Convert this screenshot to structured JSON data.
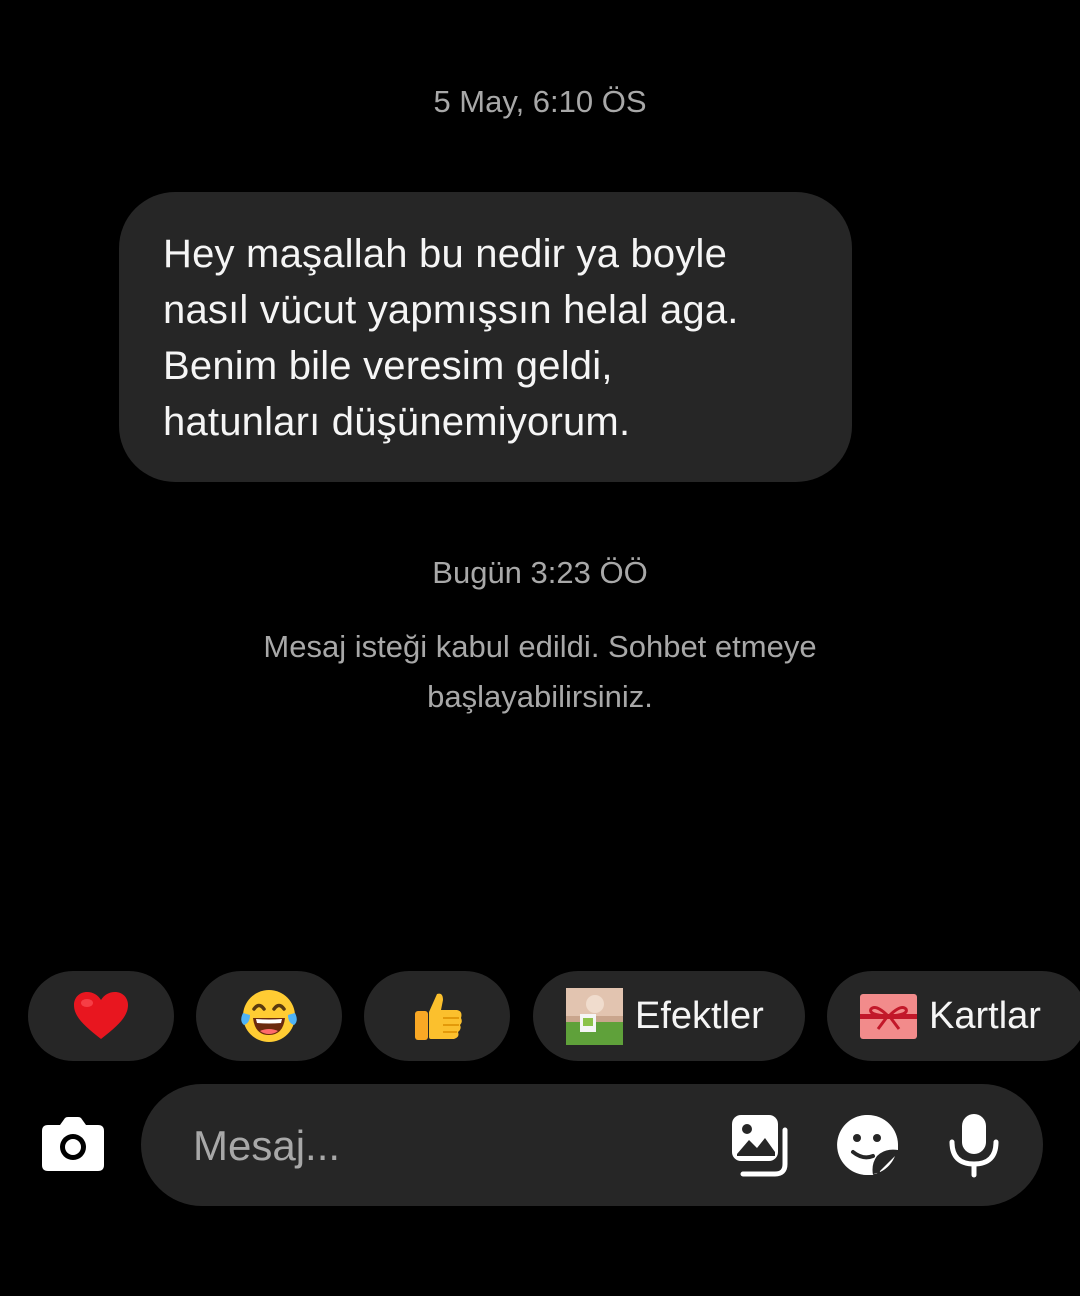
{
  "thread": {
    "first_timestamp": "5 May, 6:10 ÖS",
    "message_text": "Hey maşallah bu nedir ya boyle\nnasıl vücut yapmışsın helal aga.\nBenim bile veresim geldi,\nhatunları düşünemiyorum.",
    "second_timestamp": "Bugün 3:23 ÖÖ",
    "system_note": "Mesaj isteği kabul edildi. Sohbet etmeye başlayabilirsiniz."
  },
  "quick_actions": {
    "reactions": [
      {
        "icon": "red-heart-icon"
      },
      {
        "icon": "tears-of-joy-icon"
      },
      {
        "icon": "thumbs-up-icon"
      }
    ],
    "effects_label": "Efektler",
    "cards_label": "Kartlar"
  },
  "composer": {
    "placeholder": "Mesaj...",
    "icons": [
      "camera-icon",
      "gallery-icon",
      "sticker-icon",
      "microphone-icon"
    ]
  },
  "colors": {
    "background": "#000000",
    "bubble": "#262626",
    "secondary_text": "#a8a8a8",
    "primary_text": "#f5f5f5"
  }
}
